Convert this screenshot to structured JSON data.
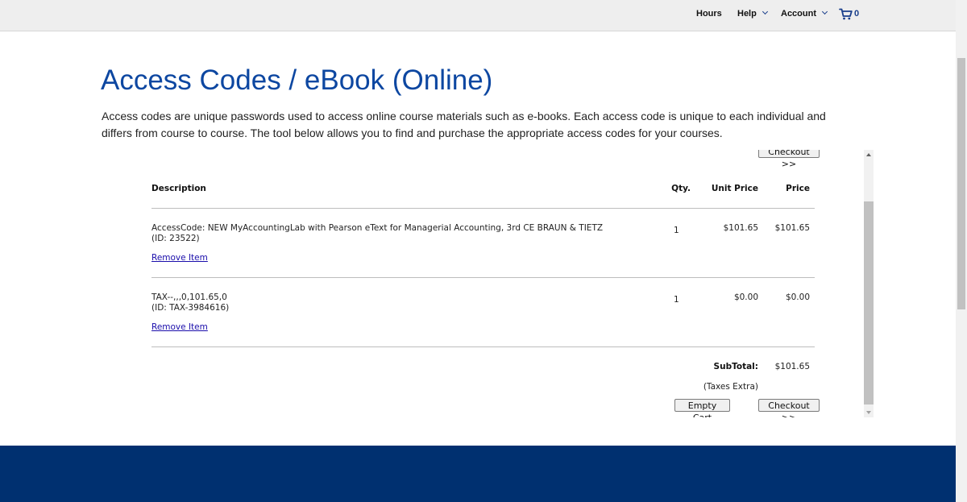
{
  "nav": {
    "hours": "Hours",
    "help": "Help",
    "account": "Account",
    "cart_count": "0"
  },
  "page": {
    "title": "Access Codes / eBook (Online)",
    "intro": "Access codes are unique passwords used to access online course materials such as e-books. Each access code is unique to each individual and differs from course to course. The tool below allows you to find and purchase the appropriate access codes for your courses."
  },
  "cart": {
    "columns": {
      "description": "Description",
      "qty": "Qty.",
      "unit_price": "Unit Price",
      "price": "Price"
    },
    "items": [
      {
        "description": "AccessCode: NEW MyAccountingLab with Pearson eText for Managerial Accounting, 3rd CE BRAUN & TIETZ",
        "id": "(ID: 23522)",
        "qty": "1",
        "unit_price": "$101.65",
        "price": "$101.65",
        "remove_label": "Remove Item"
      },
      {
        "description": "TAX--,,,0,101.65,0",
        "id": "(ID: TAX-3984616)",
        "qty": "1",
        "unit_price": "$0.00",
        "price": "$0.00",
        "remove_label": "Remove Item"
      }
    ],
    "subtotal_label": "SubTotal:",
    "subtotal_value": "$101.65",
    "taxes_note": "(Taxes Extra)",
    "empty_cart_label": "Empty Cart",
    "checkout_label": "Checkout >>"
  },
  "colors": {
    "title_blue": "#0d47a1",
    "footer_navy": "#003070",
    "link": "#1a0dab"
  }
}
